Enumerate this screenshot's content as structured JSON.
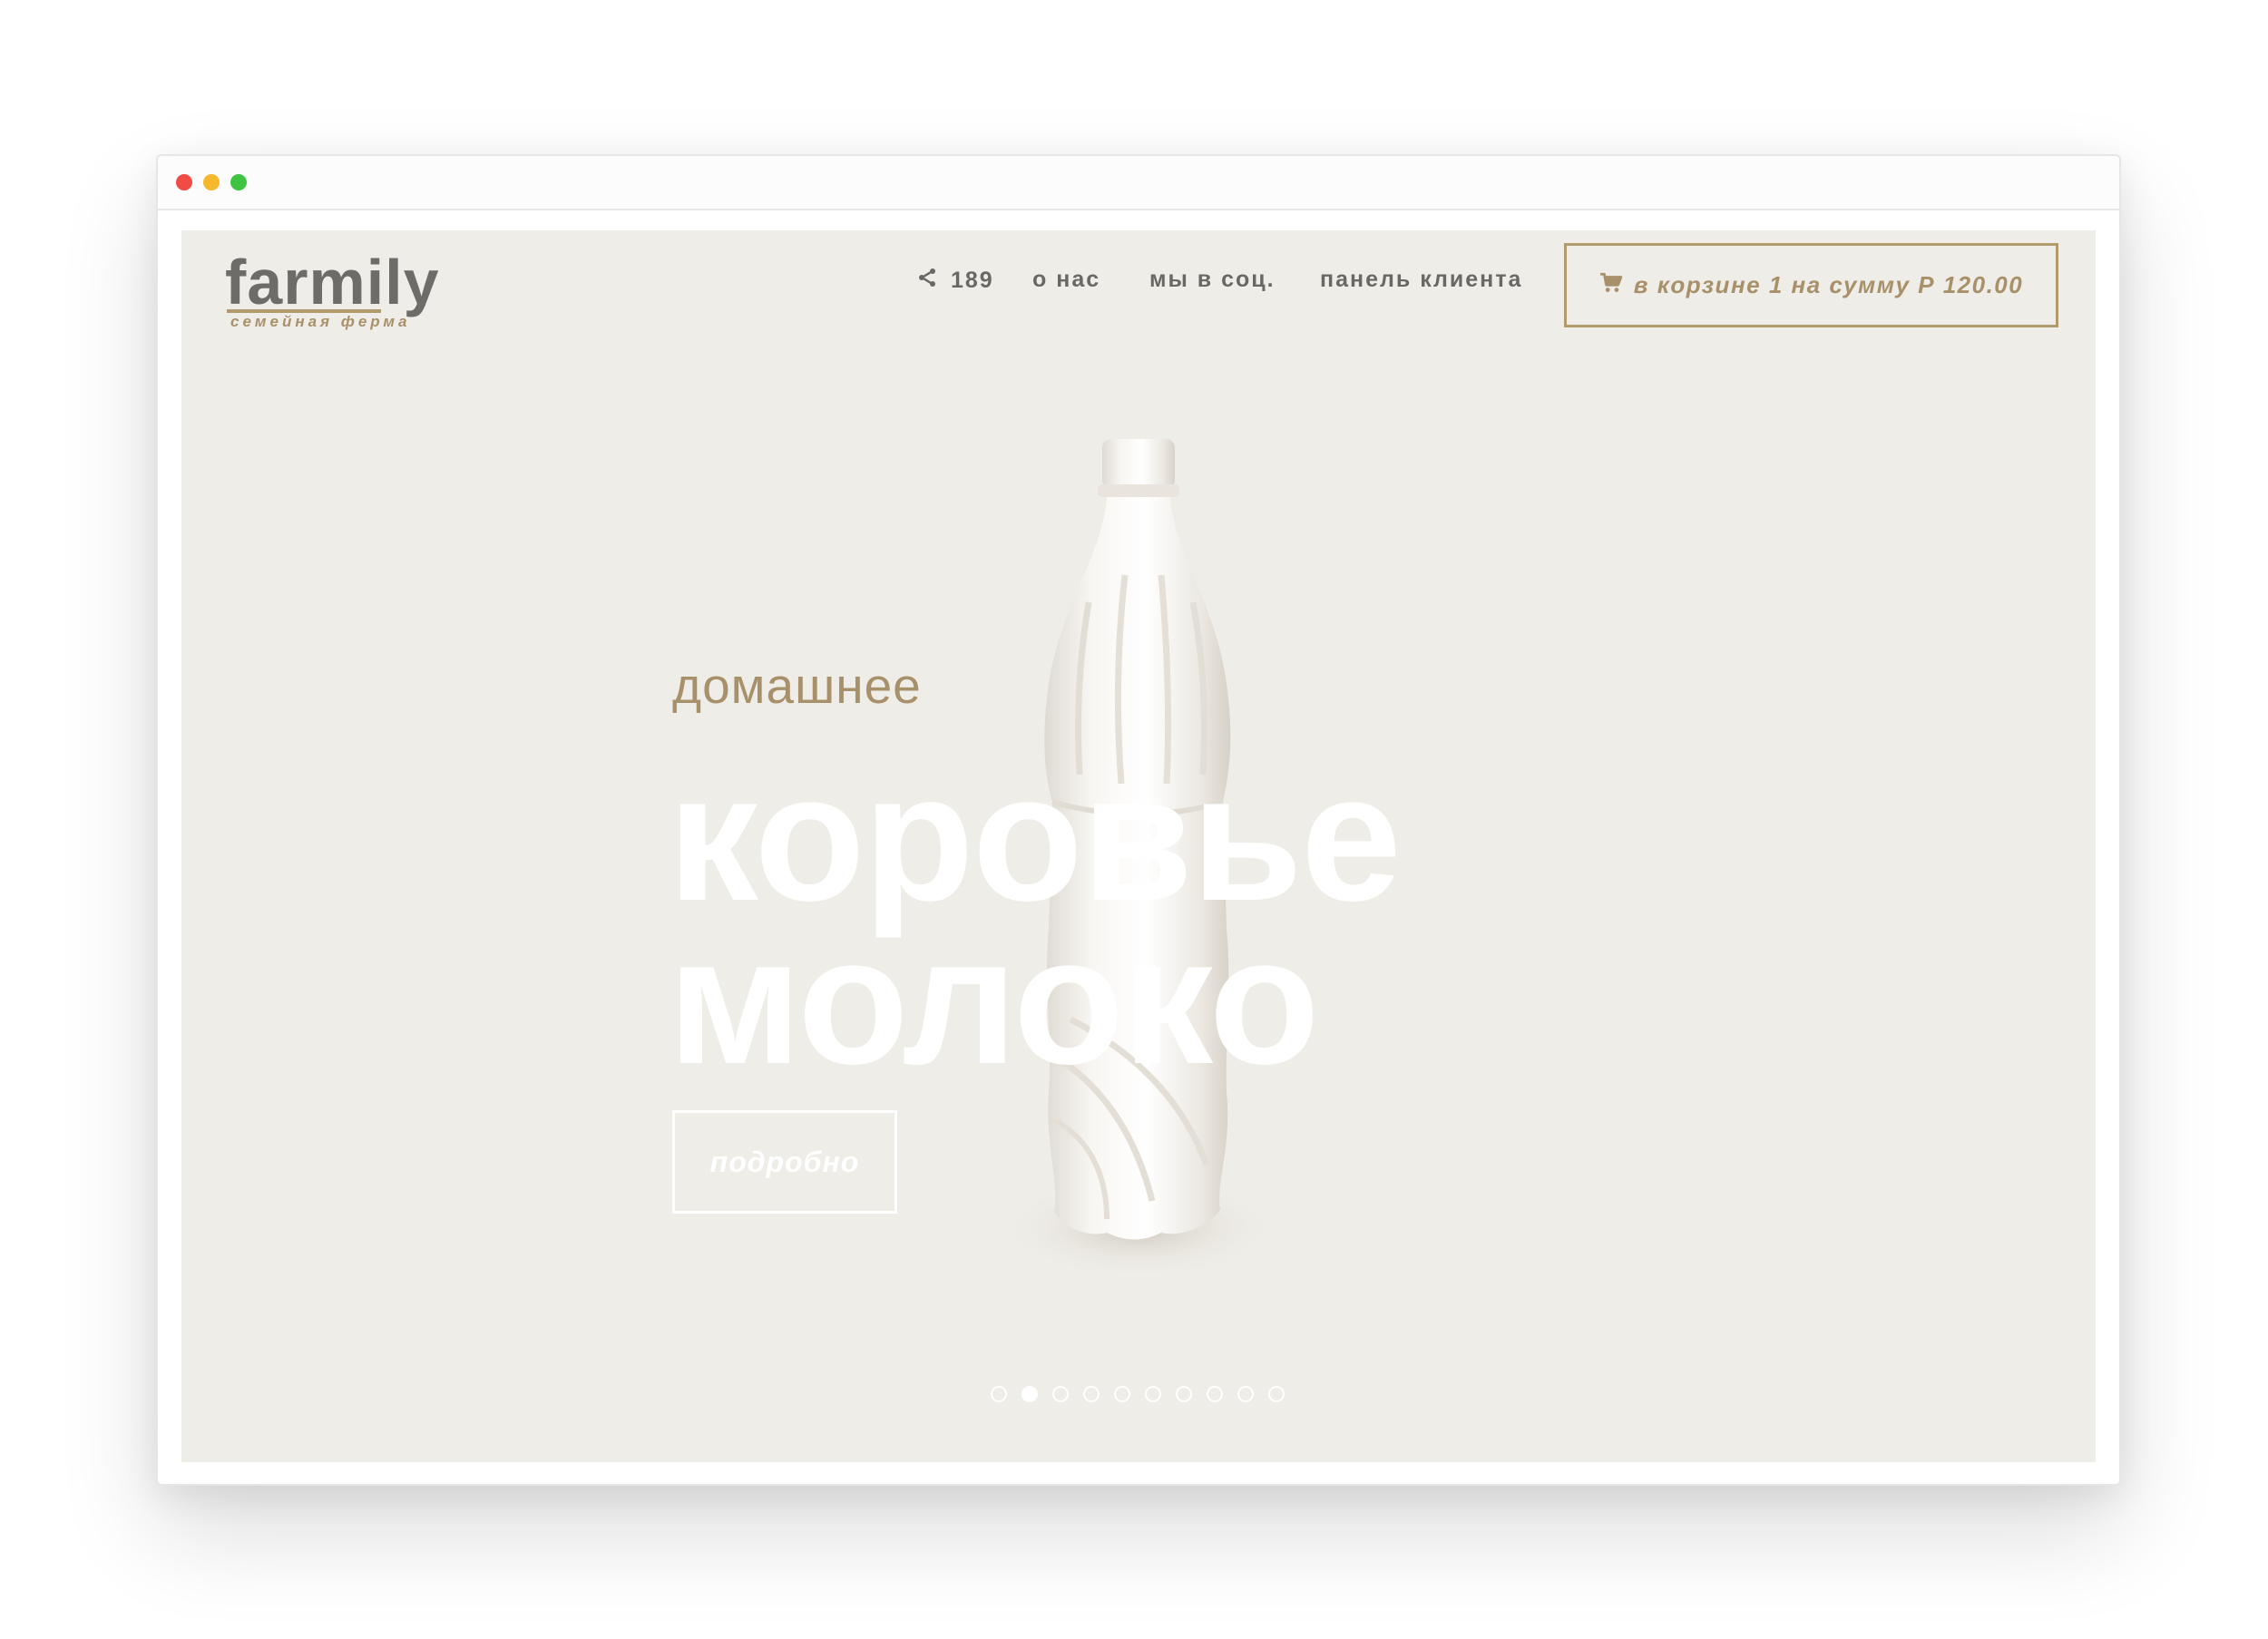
{
  "brand": {
    "name": "farmily",
    "tagline": "семейная ферма"
  },
  "nav": {
    "share_count": "189",
    "about": "о нас",
    "social": "мы в соц.",
    "client_panel": "панель клиента"
  },
  "cart": {
    "label": "в корзине 1 на сумму Р 120.00"
  },
  "hero": {
    "subtitle": "домашнее",
    "title_line1": "коровье",
    "title_line2": "молоко",
    "button_label": "подробно"
  },
  "slider": {
    "total": 10,
    "active_index": 1
  },
  "colors": {
    "background": "#efede7",
    "accent": "#b19a6c",
    "nav_text": "#6a6864",
    "hero_text": "#ffffff"
  },
  "icons": {
    "share": "share-icon",
    "cart": "cart-icon",
    "product": "milk-bottle-image"
  }
}
